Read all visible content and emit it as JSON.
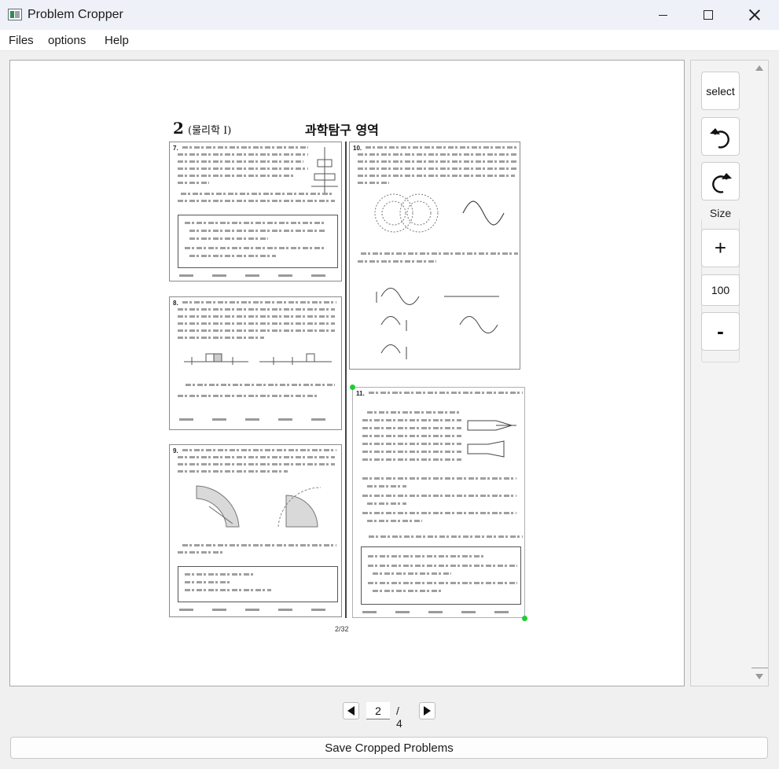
{
  "window": {
    "title": "Problem Cropper",
    "controls": {
      "minimize": "minimize",
      "maximize": "maximize",
      "close": "close"
    }
  },
  "menu": {
    "files": "Files",
    "options": "options",
    "help": "Help"
  },
  "document": {
    "page_number": "2",
    "subject": "(물리학 I)",
    "section_title": "과학탐구 영역",
    "footer": "2/32",
    "questions": [
      {
        "id": "q7",
        "number": "7."
      },
      {
        "id": "q8",
        "number": "8."
      },
      {
        "id": "q9",
        "number": "9."
      },
      {
        "id": "q10",
        "number": "10."
      },
      {
        "id": "q11",
        "number": "11."
      }
    ]
  },
  "tools": {
    "select_label": "select",
    "rotate_ccw_icon": "rotate-ccw-icon",
    "rotate_cw_icon": "rotate-cw-icon",
    "size_label": "Size",
    "plus_label": "+",
    "size_value": "100",
    "minus_label": "-"
  },
  "pager": {
    "current": "2",
    "total_label": "/ 4"
  },
  "footer": {
    "save_label": "Save Cropped Problems"
  },
  "colors": {
    "selection_handle": "#22cc33"
  }
}
